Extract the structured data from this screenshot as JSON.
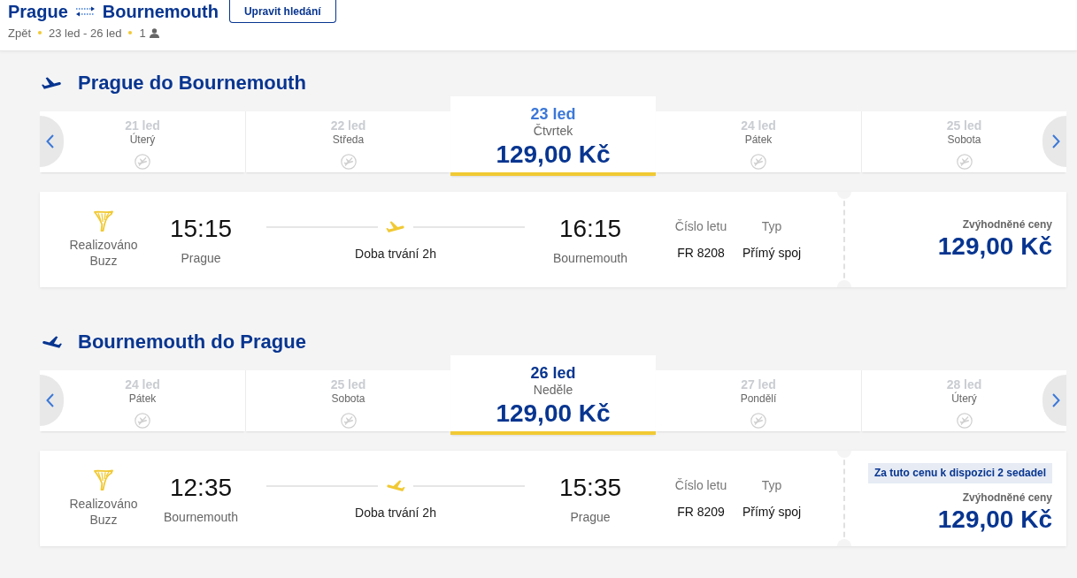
{
  "header": {
    "origin": "Prague",
    "destination": "Bournemouth",
    "edit_button": "Upravit hledání",
    "back_link": "Zpět",
    "dates": "23 led - 26 led",
    "passengers": "1"
  },
  "legs": [
    {
      "kind": "outbound",
      "title": "Prague do Bournemouth",
      "days": [
        {
          "date": "21 led",
          "weekday": "Úterý",
          "selected": false,
          "focused": false
        },
        {
          "date": "22 led",
          "weekday": "Středa",
          "selected": false,
          "focused": false
        },
        {
          "date": "23 led",
          "weekday": "Čtvrtek",
          "price": "129,00 Kč",
          "selected": true,
          "focused": true
        },
        {
          "date": "24 led",
          "weekday": "Pátek",
          "selected": false,
          "focused": false
        },
        {
          "date": "25 led",
          "weekday": "Sobota",
          "selected": false,
          "focused": false
        }
      ],
      "flight": {
        "operator": "Realizováno Buzz",
        "departure_time": "15:15",
        "departure_city": "Prague",
        "duration": "Doba trvání 2h",
        "arrival_time": "16:15",
        "arrival_city": "Bournemouth",
        "flight_number_label": "Číslo letu",
        "flight_number": "FR 8208",
        "type_label": "Typ",
        "type": "Přímý spoj",
        "price_label": "Zvýhodněné ceny",
        "price": "129,00 Kč"
      }
    },
    {
      "kind": "inbound",
      "title": "Bournemouth do Prague",
      "days": [
        {
          "date": "24 led",
          "weekday": "Pátek",
          "selected": false,
          "focused": false
        },
        {
          "date": "25 led",
          "weekday": "Sobota",
          "selected": false,
          "focused": false
        },
        {
          "date": "26 led",
          "weekday": "Neděle",
          "price": "129,00 Kč",
          "selected": true,
          "focused": false
        },
        {
          "date": "27 led",
          "weekday": "Pondělí",
          "selected": false,
          "focused": false
        },
        {
          "date": "28 led",
          "weekday": "Úterý",
          "selected": false,
          "focused": false
        }
      ],
      "flight": {
        "operator": "Realizováno Buzz",
        "departure_time": "12:35",
        "departure_city": "Bournemouth",
        "duration": "Doba trvání 2h",
        "arrival_time": "15:35",
        "arrival_city": "Prague",
        "flight_number_label": "Číslo letu",
        "flight_number": "FR 8209",
        "type_label": "Typ",
        "type": "Přímý spoj",
        "seats_badge": "Za tuto cenu k dispozici 2 sedadel",
        "price_label": "Zvýhodněné ceny",
        "price": "129,00 Kč"
      }
    }
  ]
}
